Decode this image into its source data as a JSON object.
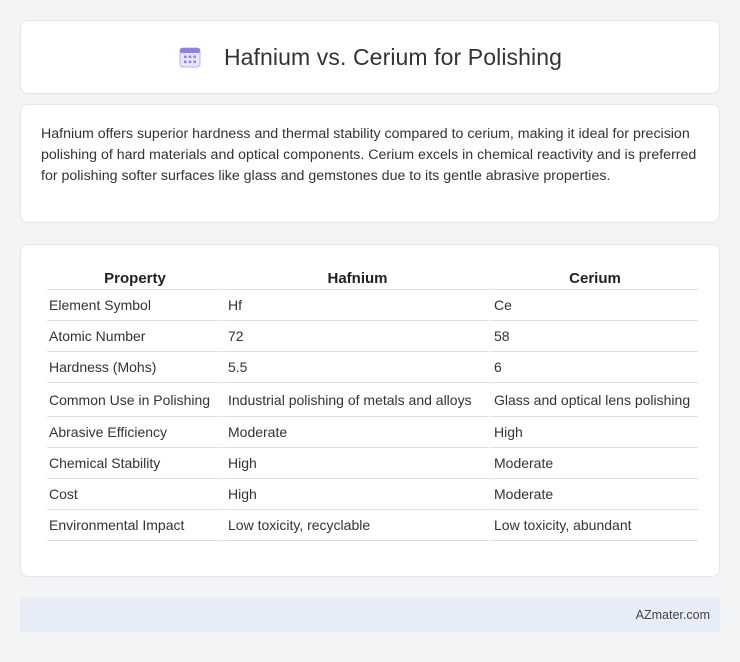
{
  "header": {
    "title": "Hafnium vs. Cerium for Polishing",
    "icon": "calendar-icon"
  },
  "summary": "Hafnium offers superior hardness and thermal stability compared to cerium, making it ideal for precision polishing of hard materials and optical components. Cerium excels in chemical reactivity and is preferred for polishing softer surfaces like glass and gemstones due to its gentle abrasive properties.",
  "table": {
    "headers": [
      "Property",
      "Hafnium",
      "Cerium"
    ],
    "rows": [
      [
        "Element Symbol",
        "Hf",
        "Ce"
      ],
      [
        "Atomic Number",
        "72",
        "58"
      ],
      [
        "Hardness (Mohs)",
        "5.5",
        "6"
      ],
      [
        "Common Use in Polishing",
        "Industrial polishing of metals and alloys",
        "Glass and optical lens polishing"
      ],
      [
        "Abrasive Efficiency",
        "Moderate",
        "High"
      ],
      [
        "Chemical Stability",
        "High",
        "Moderate"
      ],
      [
        "Cost",
        "High",
        "Moderate"
      ],
      [
        "Environmental Impact",
        "Low toxicity, recyclable",
        "Low toxicity, abundant"
      ]
    ]
  },
  "footer": {
    "text": "AZmater.com"
  },
  "colors": {
    "background": "#f3f4f6",
    "card": "#ffffff",
    "footer": "#e6edf7",
    "icon_accent": "#7b6fd6"
  }
}
